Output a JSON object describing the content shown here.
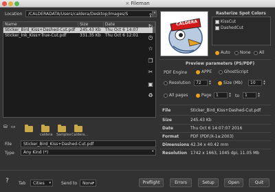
{
  "window": {
    "title": "Fileman"
  },
  "location": {
    "label": "Location",
    "value": "/CALDERADATA/Users/caldera/Desktop/Images/S"
  },
  "filelist": {
    "headers": [
      "Name",
      "Size",
      "Date"
    ],
    "rows": [
      {
        "name": "Sticker_Bird_Kiss+Dashed-Cut.pdf",
        "size": "245.43 Kb",
        "date": "Thu Oct 6 14:07"
      },
      {
        "name": "Sticker_Ink_Kiss+True-Cut.pdf",
        "size": "331.35 Kb",
        "date": "Thu Oct 6 12:01"
      }
    ]
  },
  "shortcuts": [
    {
      "label": ""
    },
    {
      "label": "caldera"
    },
    {
      "label": "Samples"
    },
    {
      "label": "Caldera..."
    }
  ],
  "file": {
    "label": "File",
    "value": "Sticker_Bird_Kiss+Dashed-Cut.pdf"
  },
  "type": {
    "label": "Type",
    "value": "Any Kind (*)"
  },
  "preview": {
    "logo_text": "CALDERA"
  },
  "rasterize": {
    "title": "Rasterize Spot Colors",
    "options": [
      "KissCut",
      "DashedCut"
    ],
    "modes": [
      "Auto",
      "None",
      "All"
    ]
  },
  "params": {
    "title": "Preview parameters (PS/PDF)",
    "engine_label": "PDF Engine",
    "engine_options": [
      "APPE",
      "GhostScript"
    ],
    "resolution_label": "Resolution",
    "resolution_value": "72",
    "size_label": "Size (Mb)",
    "size_value": "10",
    "allpages_label": "All pages",
    "page_label": "Page",
    "page_from": "1",
    "to_label": "to",
    "page_to": "1"
  },
  "info": [
    {
      "key": "File",
      "value": "Sticker_Bird_Kiss+Dashed-Cut.pdf"
    },
    {
      "key": "Size",
      "value": "245.43 Kb"
    },
    {
      "key": "Date",
      "value": "Thu Oct 6 14:07:07 2016"
    },
    {
      "key": "Format",
      "value": "PDF (PDF/X-1a:2003)"
    },
    {
      "key": "Dimensions",
      "value": "42.34 x 40.42 mm"
    },
    {
      "key": "Resolution",
      "value": "1742 x 1663, 1045 dpi, 11.05 Mb"
    }
  ],
  "bottom": {
    "help": "?",
    "tab_label": "Tab",
    "tab_value": "Cities",
    "send_label": "Send to",
    "send_value": "None",
    "buttons": [
      "Preflight",
      "Errors",
      "Setup",
      "Open",
      "Quit"
    ]
  },
  "colors": {
    "accent": "#f0a020",
    "background": "#323232"
  }
}
